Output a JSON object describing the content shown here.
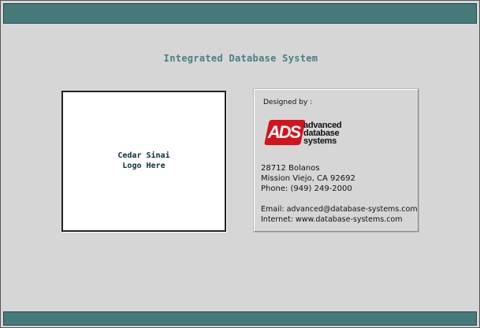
{
  "header": {
    "title": "Integrated Database System"
  },
  "logo_placeholder": {
    "line1": "Cedar Sinai",
    "line2": "Logo Here"
  },
  "designer": {
    "label": "Designed by :",
    "company_mark": "ADS",
    "company_name_lines": [
      "advanced",
      "database",
      "systems"
    ],
    "address": [
      "28712 Bolanos",
      "Mission Viejo, CA  92692",
      "Phone: (949) 249-2000"
    ],
    "email": "Email: advanced@database-systems.com",
    "internet": "Internet: www.database-systems.com"
  },
  "colors": {
    "bar": "#467a7a",
    "title": "#4a7f82",
    "ads_red": "#d3141c",
    "background": "#d6d6d6"
  }
}
